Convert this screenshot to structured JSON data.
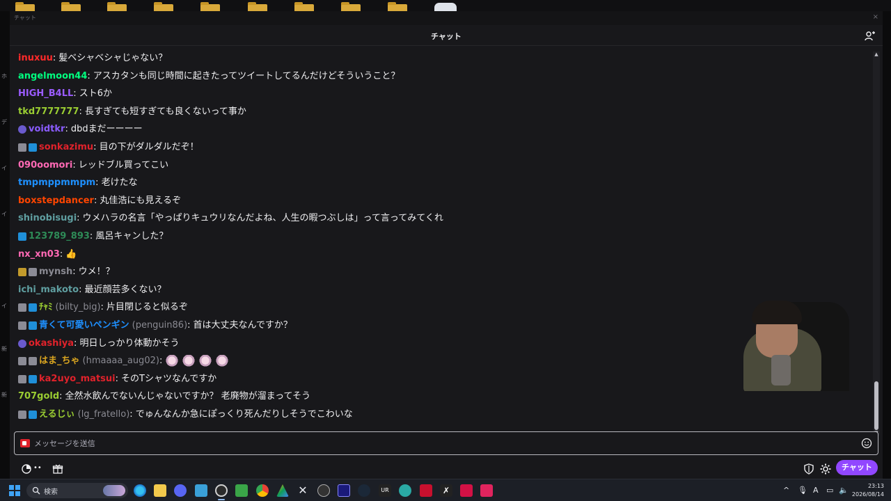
{
  "window": {
    "title": "チャット",
    "header_title": "チャット"
  },
  "messages": [
    {
      "user": "inuxuu",
      "color": "#ff2a2a",
      "text": "髪ベシャベシャじゃない？",
      "badges": []
    },
    {
      "user": "angelmoon44",
      "color": "#00ff7f",
      "text": "アスカタンも同じ時間に起きたってツイートしてるんだけどそういうこと？",
      "badges": []
    },
    {
      "user": "HIGH_B4LL",
      "color": "#9b5cff",
      "text": "スト6か",
      "badges": []
    },
    {
      "user": "tkd7777777",
      "color": "#9acd32",
      "text": "長すぎても短すぎても良くないって事か",
      "badges": []
    },
    {
      "user": "voidtkr",
      "color": "#8a5cff",
      "text": "dbdまだーーーー",
      "badges": [
        "purple"
      ]
    },
    {
      "user": "sonkazimu",
      "color": "#e0222b",
      "text": "目の下がダルダルだぞ！",
      "badges": [
        "sub",
        "prime"
      ]
    },
    {
      "user": "090oomori",
      "color": "#ff69b4",
      "text": "レッドブル買ってこい",
      "badges": []
    },
    {
      "user": "tmpmppmmpm",
      "color": "#1e90ff",
      "text": "老けたな",
      "badges": []
    },
    {
      "user": "boxstepdancer",
      "color": "#ff4500",
      "text": "丸佳浩にも見えるぞ",
      "badges": []
    },
    {
      "user": "shinobisugi",
      "color": "#5f9ea0",
      "text": "ウメハラの名言「やっぱりキュウリなんだよね、人生の暇つぶしは」って言ってみてくれ",
      "badges": []
    },
    {
      "user": "123789_893",
      "color": "#2e8b57",
      "text": "風呂キャンした？",
      "badges": [
        "prime"
      ]
    },
    {
      "user": "nx_xn03",
      "color": "#ff69b4",
      "text": "👍",
      "badges": []
    },
    {
      "user": "mynsh",
      "color": "#8a8a92",
      "text": "ウメ！？",
      "badges": [
        "gold",
        "sub"
      ]
    },
    {
      "user": "ichi_makoto",
      "color": "#5f9ea0",
      "text": "最近顔芸多くない？",
      "badges": []
    },
    {
      "user": "ﾁｬﾐ",
      "login": "(bilty_big)",
      "color": "#9acd32",
      "text": "片目閉じると似るぞ",
      "badges": [
        "sub",
        "prime"
      ]
    },
    {
      "user": "青くて可愛いペンギン",
      "login": "(penguin86)",
      "color": "#1e90ff",
      "text": "首は大丈夫なんですか？",
      "badges": [
        "sub",
        "prime"
      ]
    },
    {
      "user": "okashiya",
      "color": "#e0222b",
      "text": "明日しっかり体動かそう",
      "badges": [
        "purple"
      ]
    },
    {
      "user": "はま_ちゃ",
      "login": "(hmaaaa_aug02)",
      "color": "#daa520",
      "text": "",
      "emotes": 4,
      "badges": [
        "sub",
        "sub"
      ]
    },
    {
      "user": "ka2uyo_matsui",
      "color": "#e0222b",
      "text": "そのTシャツなんですか",
      "badges": [
        "sub",
        "prime"
      ]
    },
    {
      "user": "707gold",
      "color": "#9acd32",
      "text": "全然水飲んでないんじゃないですか？ 老廃物が溜まってそう",
      "badges": []
    },
    {
      "user": "えるじぃ",
      "login": "(lg_fratello)",
      "color": "#9acd32",
      "text": "でゅんなんか急にぽっくり死んだりしそうでこわいな",
      "badges": [
        "sub",
        "prime"
      ]
    }
  ],
  "input": {
    "placeholder": "メッセージを送信"
  },
  "controls": {
    "points": "••",
    "chat_button": "チャット"
  },
  "taskbar": {
    "search_text": "検索",
    "time": "23:13",
    "date": "2026/08/14",
    "ime": "A"
  },
  "colors": {
    "accent": "#9147ff",
    "background": "#18181b"
  }
}
